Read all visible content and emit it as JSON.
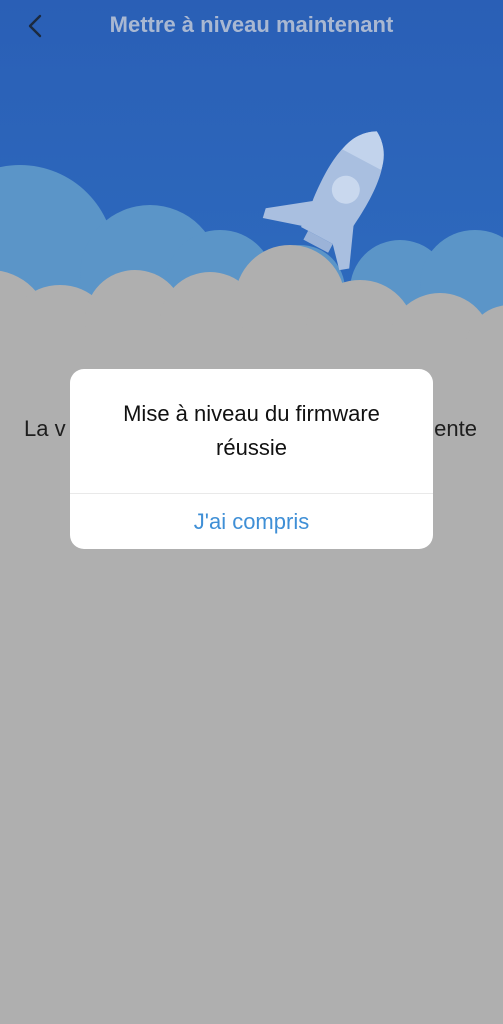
{
  "header": {
    "title": "Mettre à niveau maintenant",
    "back_icon": "chevron-left-icon"
  },
  "background": {
    "text_left": "La v",
    "text_right": "ente"
  },
  "dialog": {
    "message_line1": "Mise à niveau du firmware",
    "message_line2": "réussie",
    "button_label": "J'ai compris"
  },
  "colors": {
    "sky": "#2b62b8",
    "cloud_blue": "#5b95c8",
    "cloud_grey": "#afafaf",
    "rocket": "#a9bfe0",
    "accent": "#3f8fd6",
    "title": "#a9b8d2"
  },
  "illustration": {
    "icon": "rocket-icon"
  }
}
